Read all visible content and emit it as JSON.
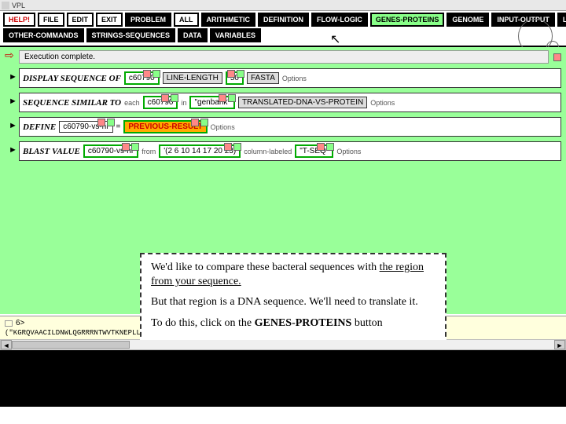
{
  "window": {
    "title": "VPL"
  },
  "toolbar": {
    "row1": [
      {
        "id": "help",
        "label": "HELP!",
        "cls": "red"
      },
      {
        "id": "file",
        "label": "FILE",
        "cls": ""
      },
      {
        "id": "edit",
        "label": "EDIT",
        "cls": ""
      },
      {
        "id": "exit",
        "label": "EXIT",
        "cls": ""
      },
      {
        "id": "problem",
        "label": "PROBLEM",
        "cls": "black"
      },
      {
        "id": "all",
        "label": "ALL",
        "cls": ""
      },
      {
        "id": "arithmetic",
        "label": "ARITHMETIC",
        "cls": "black"
      },
      {
        "id": "definition",
        "label": "DEFINITION",
        "cls": "black"
      },
      {
        "id": "flow-logic",
        "label": "FLOW-LOGIC",
        "cls": "black"
      },
      {
        "id": "genes-proteins",
        "label": "GENES-PROTEINS",
        "cls": "green-hl"
      },
      {
        "id": "genome",
        "label": "GENOME",
        "cls": "black"
      },
      {
        "id": "input-output",
        "label": "INPUT-OUTPUT",
        "cls": "black"
      },
      {
        "id": "lists-tables",
        "label": "LISTS-TABLES",
        "cls": "black"
      }
    ],
    "row2": [
      {
        "id": "other-commands",
        "label": "OTHER-COMMANDS",
        "cls": "black"
      },
      {
        "id": "strings-sequences",
        "label": "STRINGS-SEQUENCES",
        "cls": "black"
      },
      {
        "id": "data",
        "label": "DATA",
        "cls": "black"
      },
      {
        "id": "variables",
        "label": "VARIABLES",
        "cls": "black"
      }
    ]
  },
  "exec_status": {
    "text": "Execution complete."
  },
  "commands": {
    "display_seq": {
      "label": "DISPLAY SEQUENCE OF",
      "entity": "c60790",
      "opt1": "LINE-LENGTH",
      "opt1val": "50",
      "opt2": "FASTA",
      "trail": "Options"
    },
    "similar": {
      "label": "SEQUENCE SIMILAR TO",
      "sub_each": "each",
      "entity": "c60790",
      "in": "in",
      "target": "\"genbank\"",
      "method": "TRANSLATED-DNA-VS-PROTEIN",
      "trail": "Options"
    },
    "define": {
      "label": "DEFINE",
      "name": "c60790-vs-nr",
      "eq": "=",
      "value": "PREVIOUS-RESULT",
      "trail": "Options"
    },
    "blast": {
      "label": "BLAST VALUE",
      "entity": "c60790-vs-nr",
      "from": "from",
      "list": "'(2 6 10 14 17 20 23)",
      "of": "column-labeled",
      "col": "\"T-SEQ\"",
      "trail": "Options"
    }
  },
  "callout": {
    "p1a": "We'd like to compare these bacteral sequences with ",
    "p1b": "the region from your sequence.",
    "p2": "But that region is a DNA sequence. We'll need to translate it.",
    "p3a": "To do this, click on the ",
    "p3b": "GENES-PROTEINS",
    "p3c": " button"
  },
  "result": {
    "prompt": "6>",
    "output": "(\"KGRQVAACILDNWLQGRRRNTWVTKNEPLLEDARRDWTALGGVSADVQPVGNWKIDEPITLEQGVLFVTYPTLRSARGDH9RLKQILDWAGEDFEGVIE"
  }
}
